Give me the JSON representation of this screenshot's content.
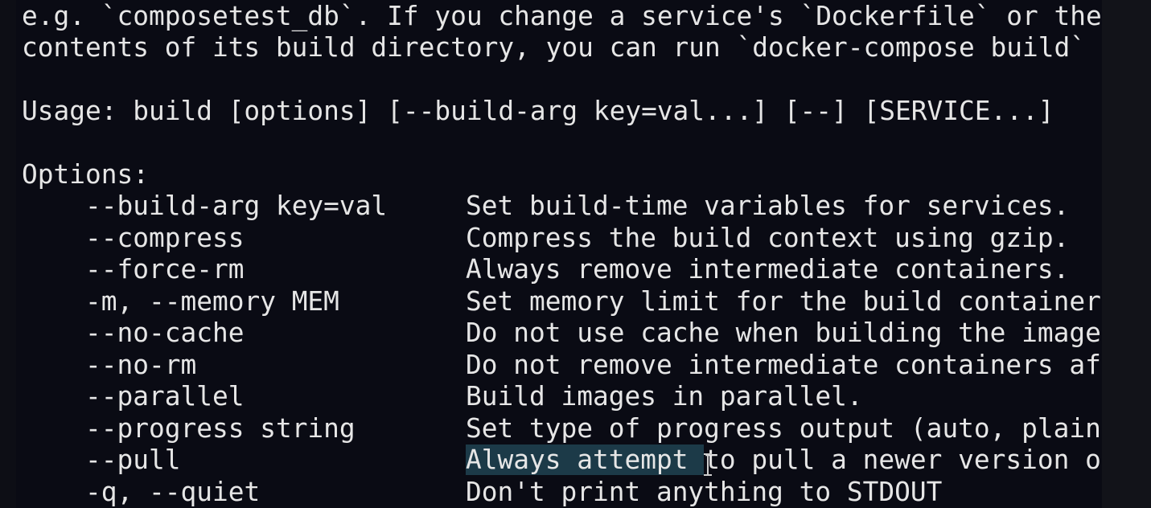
{
  "terminal": {
    "lines": [
      "e.g. `composetest_db`. If you change a service's `Dockerfile` or the",
      "contents of its build directory, you can run `docker-compose build` t",
      "",
      "Usage: build [options] [--build-arg key=val...] [--] [SERVICE...]",
      "",
      "Options:"
    ],
    "options": [
      {
        "flag": "--build-arg key=val",
        "desc": "Set build-time variables for services."
      },
      {
        "flag": "--compress",
        "desc": "Compress the build context using gzip."
      },
      {
        "flag": "--force-rm",
        "desc": "Always remove intermediate containers."
      },
      {
        "flag": "-m, --memory MEM",
        "desc": "Set memory limit for the build container"
      },
      {
        "flag": "--no-cache",
        "desc": "Do not use cache when building the image"
      },
      {
        "flag": "--no-rm",
        "desc": "Do not remove intermediate containers af"
      },
      {
        "flag": "--parallel",
        "desc": "Build images in parallel."
      },
      {
        "flag": "--progress string",
        "desc": "Set type of progress output (auto, plain"
      },
      {
        "flag": "--pull",
        "desc_selected": "Always attempt ",
        "desc_rest": "to pull a newer version o"
      },
      {
        "flag": "-q, --quiet",
        "desc": "Don't print anything to STDOUT"
      }
    ]
  },
  "colors": {
    "background": "#0a0b14",
    "text": "#e6e6e6",
    "selection": "#1c3a48"
  }
}
